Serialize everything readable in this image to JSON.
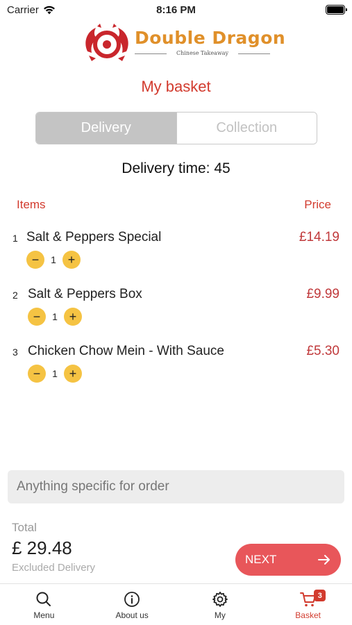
{
  "status_bar": {
    "carrier": "Carrier",
    "time": "8:16 PM"
  },
  "brand": {
    "name": "Double Dragon",
    "tagline": "Chinese Takeaway"
  },
  "page_title": "My basket",
  "mode_toggle": {
    "options": [
      "Delivery",
      "Collection"
    ],
    "selected": "Delivery"
  },
  "delivery_time": "Delivery time: 45",
  "columns": {
    "items": "Items",
    "price": "Price"
  },
  "items": [
    {
      "index": "1",
      "name": "Salt & Peppers Special",
      "quantity": "1",
      "price": "£14.19"
    },
    {
      "index": "2",
      "name": "Salt & Peppers Box",
      "quantity": "1",
      "price": "£9.99"
    },
    {
      "index": "3",
      "name": "Chicken Chow Mein - With Sauce",
      "quantity": "1",
      "price": "£5.30"
    }
  ],
  "note_field": {
    "placeholder": "Anything specific for order",
    "value": ""
  },
  "total": {
    "label": "Total",
    "value": "£ 29.48",
    "note": "Excluded Delivery"
  },
  "next_button": {
    "label": "NEXT"
  },
  "tabbar": {
    "tabs": [
      {
        "label": "Menu",
        "icon": "search-icon"
      },
      {
        "label": "About us",
        "icon": "info-icon"
      },
      {
        "label": "My",
        "icon": "gear-icon"
      },
      {
        "label": "Basket",
        "icon": "cart-icon",
        "badge": "3",
        "active": true
      }
    ]
  },
  "colors": {
    "accent": "#d23b2e",
    "stepper": "#f5c343",
    "next": "#e8565a",
    "brand": "#e0902a"
  }
}
